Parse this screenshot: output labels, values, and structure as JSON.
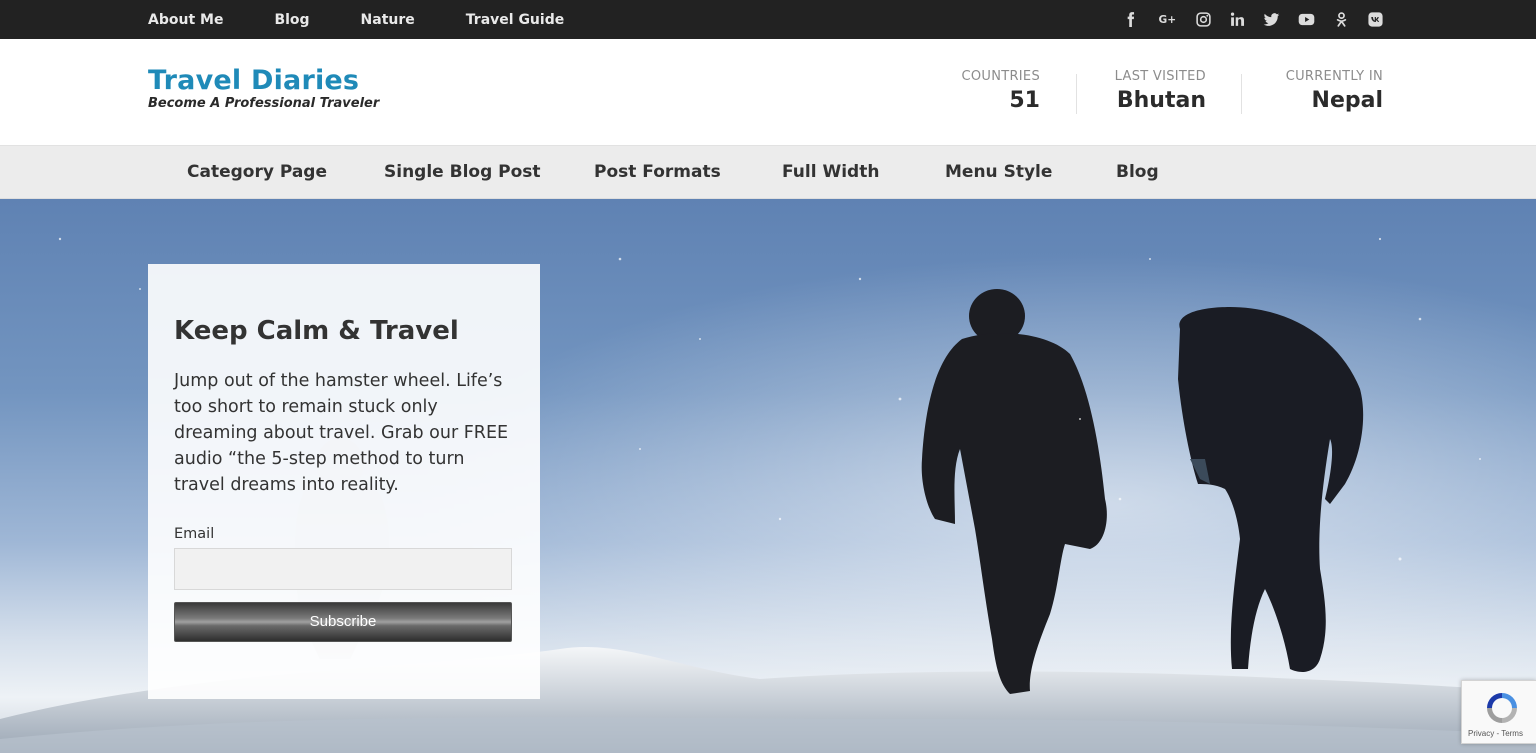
{
  "topbar": {
    "nav": [
      "About Me",
      "Blog",
      "Nature",
      "Travel Guide"
    ],
    "social_icons": [
      "facebook-icon",
      "google-plus-icon",
      "instagram-icon",
      "linkedin-icon",
      "twitter-icon",
      "youtube-icon",
      "odnoklassniki-icon",
      "vk-icon"
    ]
  },
  "header": {
    "title": "Travel Diaries",
    "tagline": "Become A Professional Traveler",
    "stats": [
      {
        "label": "COUNTRIES",
        "value": "51"
      },
      {
        "label": "LAST VISITED",
        "value": "Bhutan"
      },
      {
        "label": "CURRENTLY IN",
        "value": "Nepal"
      }
    ]
  },
  "mainnav": {
    "items": [
      "Category Page",
      "Single Blog Post",
      "Post Formats",
      "Full Width",
      "Menu Style",
      "Blog"
    ]
  },
  "card": {
    "title": "Keep Calm & Travel",
    "body": "Jump out of the hamster wheel. Life’s too short to remain stuck only dreaming about travel. Grab our FREE audio “the 5-step method to turn travel dreams into reality.",
    "email_label": "Email",
    "email_value": "",
    "button_label": "Subscribe"
  },
  "recaptcha": {
    "terms": "Privacy - Terms"
  },
  "colors": {
    "brand": "#1f8ab8",
    "topbar": "#222222",
    "nav_bg": "#ececec"
  }
}
